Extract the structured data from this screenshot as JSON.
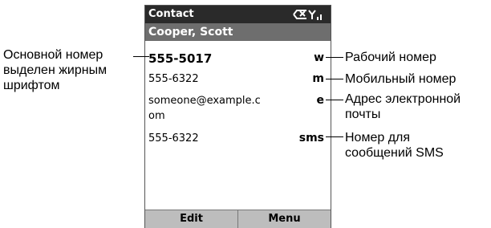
{
  "phone": {
    "title": "Contact",
    "status_icon": "signal-icon",
    "contact_name": "Cooper, Scott",
    "entries": [
      {
        "value": "555-5017",
        "type": "w",
        "primary": true
      },
      {
        "value": "555-6322",
        "type": "m",
        "primary": false
      },
      {
        "value_line1": "someone@example.c",
        "value_line2": "om",
        "type": "e",
        "primary": false
      },
      {
        "value": "555-6322",
        "type": "sms",
        "primary": false
      }
    ],
    "softkeys": {
      "left": "Edit",
      "right": "Menu"
    }
  },
  "callouts": {
    "primary_number": [
      "Основной номер",
      "выделен жирным",
      "шрифтом"
    ],
    "work": "Рабочий номер",
    "mobile": "Мобильный номер",
    "email": [
      "Адрес электронной",
      "почты"
    ],
    "sms": [
      "Номер для",
      "сообщений SMS"
    ]
  },
  "colors": {
    "titlebar": "#2a2a2a",
    "namebar": "#6e6e6e",
    "softkeys": "#bdbdbd"
  }
}
